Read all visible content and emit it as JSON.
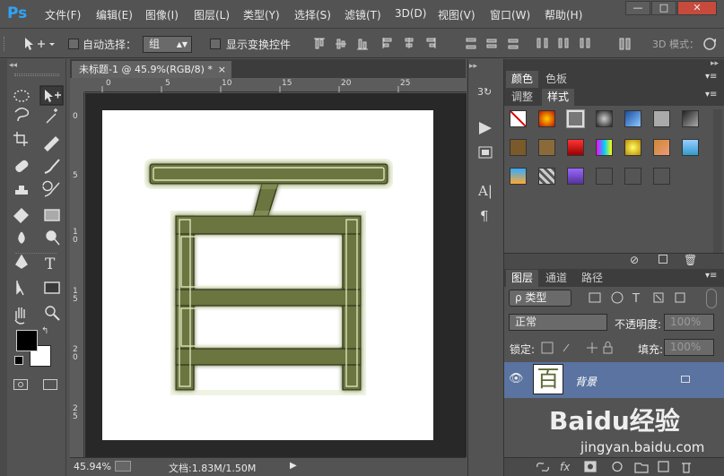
{
  "app": {
    "logo": "Ps"
  },
  "menu": [
    "文件(F)",
    "编辑(E)",
    "图像(I)",
    "图层(L)",
    "类型(Y)",
    "选择(S)",
    "滤镜(T)",
    "3D(D)",
    "视图(V)",
    "窗口(W)",
    "帮助(H)"
  ],
  "window_controls": {
    "minimize": "—",
    "maximize": "□",
    "close": "✕"
  },
  "options": {
    "auto_select_label": "自动选择：",
    "auto_select_value": "组",
    "show_transform_label": "显示变换控件",
    "mode_3d_label": "3D 模式："
  },
  "document": {
    "tab_title": "未标题-1 @ 45.9%(RGB/8) *",
    "tab_close": "×",
    "char": "百",
    "zoom": "45.94%",
    "doc_info": "文档:1.83M/1.50M",
    "ruler_h": [
      "0",
      "5",
      "10",
      "15",
      "20",
      "25"
    ],
    "ruler_v": [
      "0",
      "5",
      "1\n0",
      "1\n5",
      "2\n0",
      "2\n5"
    ]
  },
  "panels": {
    "color_tab": "颜色",
    "swatches_tab": "色板",
    "adjust_tab": "调整",
    "styles_tab": "样式",
    "layers_tab": "图层",
    "channels_tab": "通道",
    "paths_tab": "路径",
    "filter_type": "ρ 类型",
    "blend_mode": "正常",
    "opacity_label": "不透明度:",
    "opacity_value": "100%",
    "lock_label": "锁定:",
    "fill_label": "填充:",
    "fill_value": "100%",
    "layer_name": "背景",
    "thumb_char": "百"
  },
  "watermark": {
    "brand": "Baidu经验",
    "url": "jingyan.baidu.com"
  },
  "colors": {
    "accent": "#2fa3f6",
    "glyph": "#5f6a35",
    "selected_layer": "#5a73a0"
  }
}
